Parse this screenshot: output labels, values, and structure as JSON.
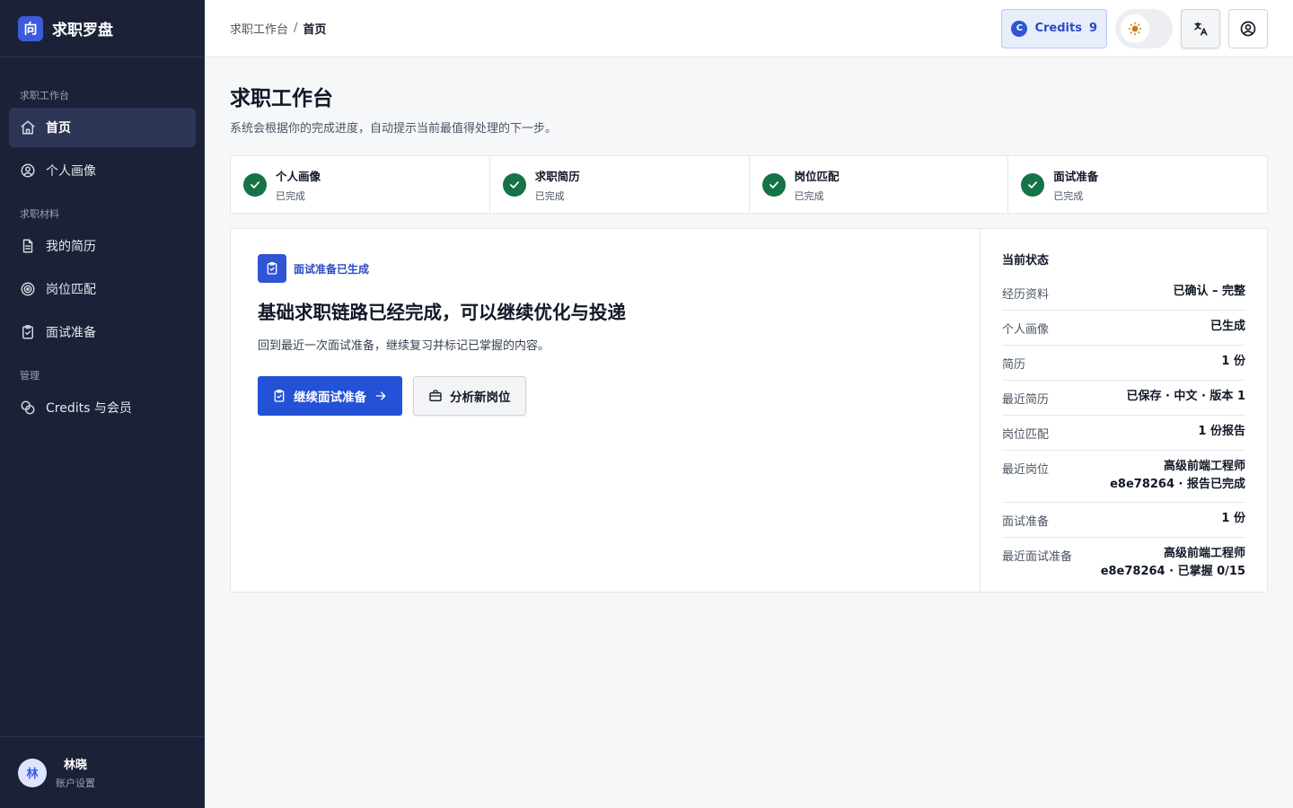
{
  "brand": {
    "logo": "向",
    "name": "求职罗盘"
  },
  "sidebar": {
    "sections": [
      {
        "label": "求职工作台",
        "items": [
          {
            "label": "首页",
            "icon": "home-icon"
          },
          {
            "label": "个人画像",
            "icon": "user-circle-icon"
          }
        ]
      },
      {
        "label": "求职材料",
        "items": [
          {
            "label": "我的简历",
            "icon": "document-icon"
          },
          {
            "label": "岗位匹配",
            "icon": "target-icon"
          },
          {
            "label": "面试准备",
            "icon": "clipboard-check-icon"
          }
        ]
      },
      {
        "label": "管理",
        "items": [
          {
            "label": "Credits 与会员",
            "icon": "coins-icon"
          }
        ]
      }
    ],
    "user": {
      "avatar": "林",
      "name": "林晓",
      "sub": "账户设置"
    }
  },
  "header": {
    "breadcrumb": [
      "求职工作台",
      "首页"
    ],
    "breadcrumb_sep": "/",
    "credits_icon": "C",
    "credits_label": "Credits",
    "credits_value": "9",
    "theme_icon": "sun-icon",
    "translate_icon": "translate-icon",
    "account_icon": "account-icon"
  },
  "page": {
    "title": "求职工作台",
    "subtitle": "系统会根据你的完成进度，自动提示当前最值得处理的下一步。"
  },
  "steps": [
    {
      "title": "个人画像",
      "status": "已完成"
    },
    {
      "title": "求职简历",
      "status": "已完成"
    },
    {
      "title": "岗位匹配",
      "status": "已完成"
    },
    {
      "title": "面试准备",
      "status": "已完成"
    }
  ],
  "hero": {
    "badge": "面试准备已生成",
    "title": "基础求职链路已经完成，可以继续优化与投递",
    "subtitle": "回到最近一次面试准备，继续复习并标记已掌握的内容。",
    "primary_button": "继续面试准备",
    "secondary_button": "分析新岗位"
  },
  "status": {
    "title": "当前状态",
    "rows": [
      {
        "k": "经历资料",
        "v": [
          "已确认 – 完整"
        ]
      },
      {
        "k": "个人画像",
        "v": [
          "已生成"
        ]
      },
      {
        "k": "简历",
        "v": [
          "1 份"
        ]
      },
      {
        "k": "最近简历",
        "v": [
          "已保存 · 中文 · 版本 1"
        ]
      },
      {
        "k": "岗位匹配",
        "v": [
          "1 份报告"
        ]
      },
      {
        "k": "最近岗位",
        "v": [
          "高级前端工程师",
          "e8e78264 · 报告已完成"
        ]
      },
      {
        "k": "面试准备",
        "v": [
          "1 份"
        ]
      },
      {
        "k": "最近面试准备",
        "v": [
          "高级前端工程师",
          "e8e78264 · 已掌握 0/15"
        ]
      }
    ]
  },
  "colors": {
    "accent": "#2452d6",
    "sidebar_bg": "#1b2238",
    "success": "#157347"
  }
}
